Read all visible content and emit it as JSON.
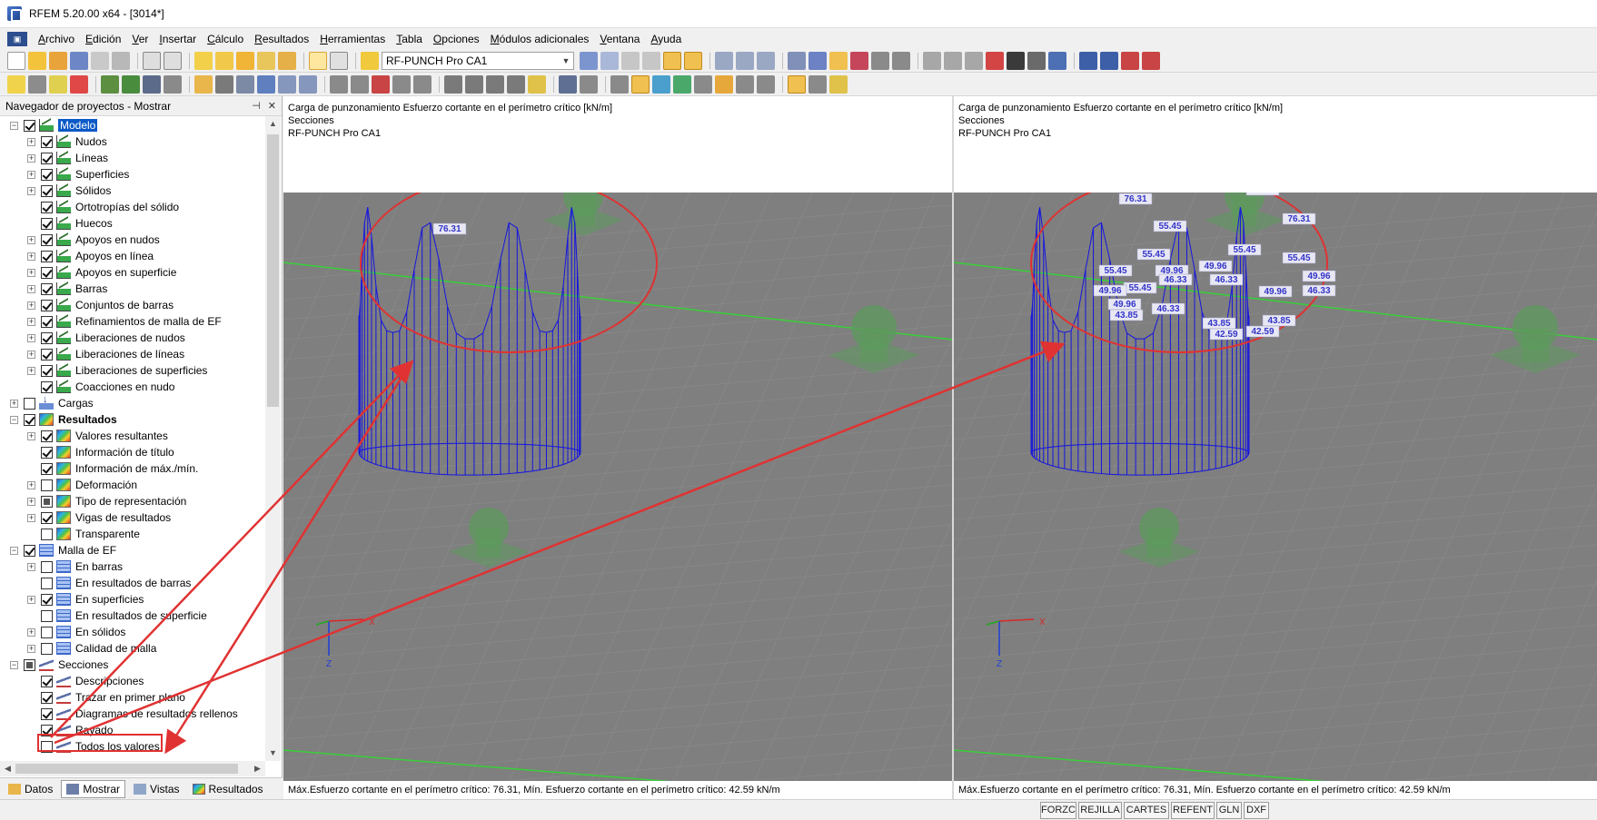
{
  "window": {
    "title": "RFEM 5.20.00 x64 - [3014*]"
  },
  "menu": [
    "Archivo",
    "Edición",
    "Ver",
    "Insertar",
    "Cálculo",
    "Resultados",
    "Herramientas",
    "Tabla",
    "Opciones",
    "Módulos adicionales",
    "Ventana",
    "Ayuda"
  ],
  "toolbar": {
    "load_case": "RF-PUNCH Pro CA1"
  },
  "navigator": {
    "title": "Navegador de proyectos - Mostrar",
    "items": [
      {
        "label": "Modelo",
        "level": 0,
        "exp": "−",
        "check": "on",
        "icon": "chart",
        "style": "sel"
      },
      {
        "label": "Nudos",
        "level": 1,
        "exp": "+",
        "check": "on",
        "icon": "chart"
      },
      {
        "label": "Líneas",
        "level": 1,
        "exp": "+",
        "check": "on",
        "icon": "chart"
      },
      {
        "label": "Superficies",
        "level": 1,
        "exp": "+",
        "check": "on",
        "icon": "chart"
      },
      {
        "label": "Sólidos",
        "level": 1,
        "exp": "+",
        "check": "on",
        "icon": "chart"
      },
      {
        "label": "Ortotropías del sólido",
        "level": 1,
        "exp": "",
        "check": "on",
        "icon": "chart"
      },
      {
        "label": "Huecos",
        "level": 1,
        "exp": "",
        "check": "on",
        "icon": "chart"
      },
      {
        "label": "Apoyos en nudos",
        "level": 1,
        "exp": "+",
        "check": "on",
        "icon": "chart"
      },
      {
        "label": "Apoyos en línea",
        "level": 1,
        "exp": "+",
        "check": "on",
        "icon": "chart"
      },
      {
        "label": "Apoyos en superficie",
        "level": 1,
        "exp": "+",
        "check": "on",
        "icon": "chart"
      },
      {
        "label": "Barras",
        "level": 1,
        "exp": "+",
        "check": "on",
        "icon": "chart"
      },
      {
        "label": "Conjuntos de barras",
        "level": 1,
        "exp": "+",
        "check": "on",
        "icon": "chart"
      },
      {
        "label": "Refinamientos de malla de EF",
        "level": 1,
        "exp": "+",
        "check": "on",
        "icon": "chart"
      },
      {
        "label": "Liberaciones de nudos",
        "level": 1,
        "exp": "+",
        "check": "on",
        "icon": "chart"
      },
      {
        "label": "Liberaciones de líneas",
        "level": 1,
        "exp": "+",
        "check": "on",
        "icon": "chart"
      },
      {
        "label": "Liberaciones de superficies",
        "level": 1,
        "exp": "+",
        "check": "on",
        "icon": "chart"
      },
      {
        "label": "Coacciones en nudo",
        "level": 1,
        "exp": "",
        "check": "on",
        "icon": "chart"
      },
      {
        "label": "Cargas",
        "level": 0,
        "exp": "+",
        "check": "off",
        "icon": "load"
      },
      {
        "label": "Resultados",
        "level": 0,
        "exp": "−",
        "check": "on",
        "icon": "rainbow",
        "style": "bold"
      },
      {
        "label": "Valores resultantes",
        "level": 1,
        "exp": "+",
        "check": "on",
        "icon": "rainbow"
      },
      {
        "label": "Información de título",
        "level": 1,
        "exp": "",
        "check": "on",
        "icon": "rainbow"
      },
      {
        "label": "Información de máx./mín.",
        "level": 1,
        "exp": "",
        "check": "on",
        "icon": "rainbow"
      },
      {
        "label": "Deformación",
        "level": 1,
        "exp": "+",
        "check": "off",
        "icon": "rainbow"
      },
      {
        "label": "Tipo de representación",
        "level": 1,
        "exp": "+",
        "check": "part",
        "icon": "rainbow"
      },
      {
        "label": "Vigas de resultados",
        "level": 1,
        "exp": "+",
        "check": "on",
        "icon": "rainbow"
      },
      {
        "label": "Transparente",
        "level": 1,
        "exp": "",
        "check": "off",
        "icon": "rainbow"
      },
      {
        "label": "Malla de EF",
        "level": 0,
        "exp": "−",
        "check": "on",
        "icon": "grid"
      },
      {
        "label": "En barras",
        "level": 1,
        "exp": "+",
        "check": "off",
        "icon": "grid"
      },
      {
        "label": "En resultados de barras",
        "level": 1,
        "exp": "",
        "check": "off",
        "icon": "grid"
      },
      {
        "label": "En superficies",
        "level": 1,
        "exp": "+",
        "check": "on",
        "icon": "grid"
      },
      {
        "label": "En resultados de superficie",
        "level": 1,
        "exp": "",
        "check": "off",
        "icon": "grid"
      },
      {
        "label": "En sólidos",
        "level": 1,
        "exp": "+",
        "check": "off",
        "icon": "grid"
      },
      {
        "label": "Calidad de malla",
        "level": 1,
        "exp": "+",
        "check": "off",
        "icon": "grid"
      },
      {
        "label": "Secciones",
        "level": 0,
        "exp": "−",
        "check": "part",
        "icon": "sec"
      },
      {
        "label": "Descripciones",
        "level": 1,
        "exp": "",
        "check": "on",
        "icon": "sec"
      },
      {
        "label": "Trazar en primer plano",
        "level": 1,
        "exp": "",
        "check": "on",
        "icon": "sec"
      },
      {
        "label": "Diagramas de resultados rellenos",
        "level": 1,
        "exp": "",
        "check": "on",
        "icon": "sec"
      },
      {
        "label": "Rayado",
        "level": 1,
        "exp": "",
        "check": "on",
        "icon": "sec"
      },
      {
        "label": "Todos los valores",
        "level": 1,
        "exp": "",
        "check": "off",
        "icon": "sec"
      }
    ],
    "tabs": [
      "Datos",
      "Mostrar",
      "Vistas",
      "Resultados"
    ]
  },
  "viewport_left": {
    "title_lines": [
      "Carga de punzonamiento Esfuerzo cortante en el perímetro crítico [kN/m]",
      "Secciones",
      "RF-PUNCH Pro CA1"
    ],
    "labels": [
      "76.31"
    ],
    "footer": "Máx.Esfuerzo cortante en el perímetro crítico: 76.31, Mín. Esfuerzo cortante en el perímetro crítico: 42.59 kN/m"
  },
  "viewport_right": {
    "title_lines": [
      "Carga de punzonamiento Esfuerzo cortante en el perímetro crítico [kN/m]",
      "Secciones",
      "RF-PUNCH Pro CA1"
    ],
    "labels": [
      "76.31",
      "76.31",
      "76.31",
      "55.45",
      "55.45",
      "55.45",
      "55.45",
      "55.45",
      "55.45",
      "49.96",
      "49.96",
      "49.96",
      "49.96",
      "49.96",
      "49.96",
      "46.33",
      "46.33",
      "46.33",
      "46.33",
      "43.85",
      "43.85",
      "43.85",
      "42.59",
      "42.59"
    ],
    "footer": "Máx.Esfuerzo cortante en el perímetro crítico: 76.31, Mín. Esfuerzo cortante en el perímetro crítico: 42.59 kN/m"
  },
  "axes": {
    "x": "X",
    "z": "Z"
  },
  "statusbar": [
    "FORZC",
    "REJILLA",
    "CARTES",
    "REFENT",
    "GLN",
    "DXF"
  ],
  "colors": {
    "diagram": "#1515e0",
    "plate": "#7f7f7f",
    "highlight": "#e03232",
    "support": "#5c9a5c",
    "accent": "#0a59c7"
  }
}
